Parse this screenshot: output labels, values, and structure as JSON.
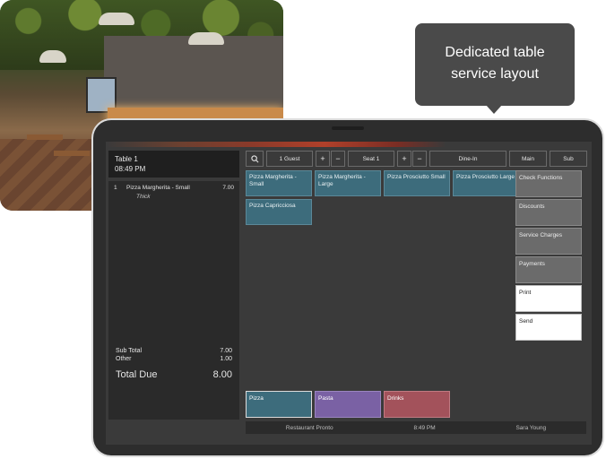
{
  "callout": {
    "line1": "Dedicated table",
    "line2": "service layout"
  },
  "order": {
    "table": "Table 1",
    "time": "08:49 PM",
    "items": [
      {
        "qty": "1",
        "name": "Pizza Margherita - Small",
        "price": "7.00",
        "modifier": "Thick"
      }
    ],
    "subtotal_label": "Sub Total",
    "subtotal_value": "7.00",
    "other_label": "Other",
    "other_value": "1.00",
    "total_label": "Total Due",
    "total_value": "8.00"
  },
  "toolbar": {
    "search_icon": "search-icon",
    "guests": "1 Guest",
    "plus": "+",
    "minus": "−",
    "seat": "Seat 1",
    "mode": "Dine-In",
    "main": "Main",
    "sub": "Sub"
  },
  "menu_items": [
    {
      "label": "Pizza Margherita - Small"
    },
    {
      "label": "Pizza Margherita - Large"
    },
    {
      "label": "Pizza Prosciutto Small"
    },
    {
      "label": "Pizza Prosciutto Large"
    },
    {
      "label": "Pizza Capricciosa"
    }
  ],
  "side_actions": [
    {
      "label": "Check Functions"
    },
    {
      "label": "Discounts"
    },
    {
      "label": "Service Charges"
    },
    {
      "label": "Payments"
    },
    {
      "label": "Print"
    },
    {
      "label": "Send"
    }
  ],
  "categories": [
    {
      "label": "Pizza",
      "color": "#3d6c7c"
    },
    {
      "label": "Pasta",
      "color": "#7a61a4"
    },
    {
      "label": "Drinks",
      "color": "#a3525b"
    }
  ],
  "status": {
    "restaurant": "Restaurant Pronto",
    "time": "8:49  PM",
    "user": "Sara Young"
  }
}
